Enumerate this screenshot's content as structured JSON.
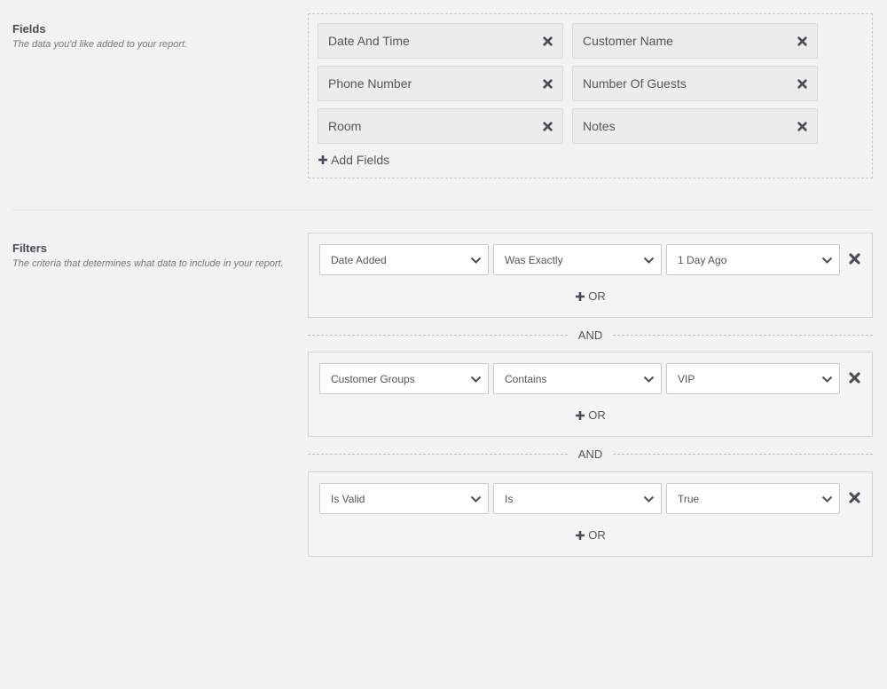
{
  "fields_section": {
    "title": "Fields",
    "description": "The data you'd like added to your report.",
    "fields": [
      {
        "label": "Date And Time"
      },
      {
        "label": "Customer Name"
      },
      {
        "label": "Phone Number"
      },
      {
        "label": "Number Of Guests"
      },
      {
        "label": "Room"
      },
      {
        "label": "Notes"
      }
    ],
    "add_label": "Add Fields"
  },
  "filters_section": {
    "title": "Filters",
    "description": "The criteria that determines what data to include in your report.",
    "and_label": "AND",
    "or_label": "OR",
    "filters": [
      {
        "field": "Date Added",
        "operator": "Was Exactly",
        "value": "1 Day Ago"
      },
      {
        "field": "Customer Groups",
        "operator": "Contains",
        "value": "VIP"
      },
      {
        "field": "Is Valid",
        "operator": "Is",
        "value": "True"
      }
    ]
  },
  "icons": {
    "remove": "x-icon",
    "add": "plus-icon",
    "dropdown": "chevron-down-icon"
  },
  "colors": {
    "background": "#f2f2f2",
    "icon": "#4a4a5a",
    "text": "#555555"
  }
}
